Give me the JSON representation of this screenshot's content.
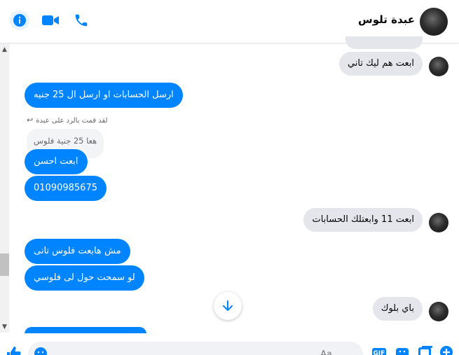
{
  "header": {
    "contact_name": "عبدة تلوس"
  },
  "messages": {
    "in_1": "ابعت هم ليك تاني",
    "out_1": "ارسل الحسابات او ارسل ال 25 جنيه",
    "reply_note": "لقد قمت بالرد على عبدة",
    "quoted": "هعا 25 جنية فلوس",
    "out_2": "ابعت احسن",
    "out_3": "01090985675",
    "in_2": "ابعت 11 وابعتلك الحسابات",
    "out_4": "مش هابعت فلوس تانى",
    "out_5": "لو سمحت حول لى فلوسي",
    "in_3": "باي بلوك"
  },
  "composer": {
    "placeholder": "Aa"
  },
  "colors": {
    "accent": "#0084ff",
    "incoming_bubble": "#e4e6eb"
  },
  "icons": [
    "info-icon",
    "video-call-icon",
    "phone-call-icon",
    "like-icon",
    "emoji-icon",
    "gif-icon",
    "sticker-icon",
    "photo-icon",
    "plus-icon",
    "arrow-down-icon"
  ]
}
